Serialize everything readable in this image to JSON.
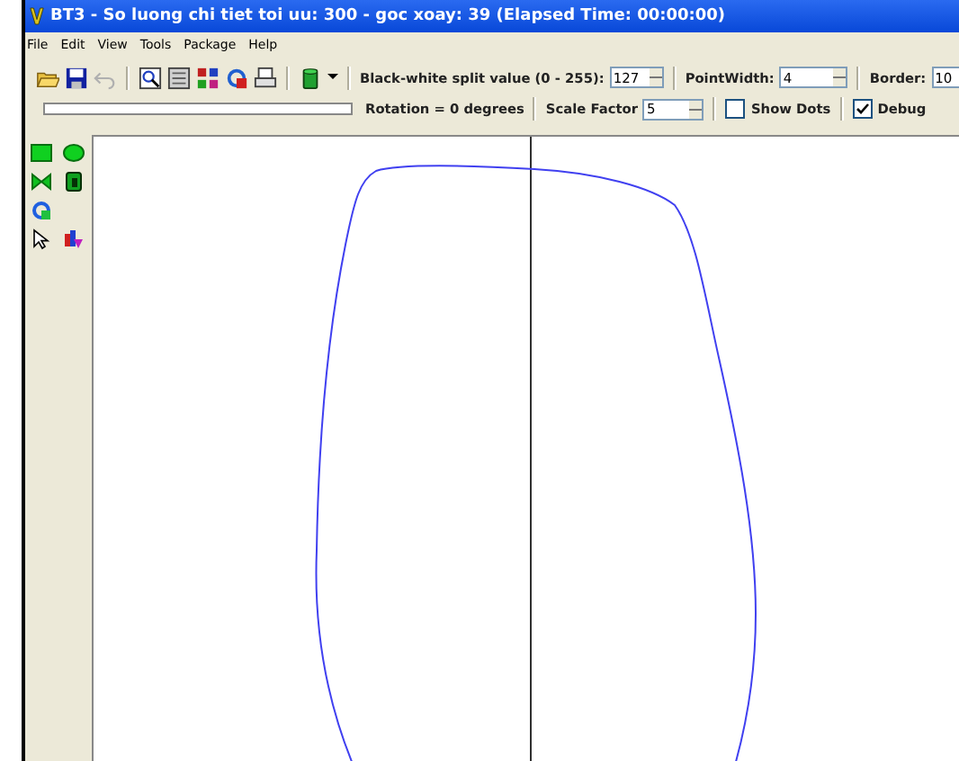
{
  "window": {
    "title": "BT3 - So luong chi tiet toi uu: 300 - goc xoay: 39 (Elapsed Time: 00:00:00)"
  },
  "menu": [
    "File",
    "Edit",
    "View",
    "Tools",
    "Package",
    "Help"
  ],
  "toolbar": {
    "split_label": "Black-white split value (0 - 255):",
    "split_value": "127",
    "pointwidth_label": "PointWidth:",
    "pointwidth_value": "4",
    "border_label": "Border:",
    "border_value": "10"
  },
  "toolbar2": {
    "progress": {
      "level": 0
    },
    "rotation": "Rotation = 0 degrees",
    "scale_label": "Scale Factor",
    "scale_value": "5",
    "checkboxes": [
      {
        "label": "Show Dots",
        "checked": false
      },
      {
        "label": "Debug",
        "checked": true
      }
    ]
  }
}
